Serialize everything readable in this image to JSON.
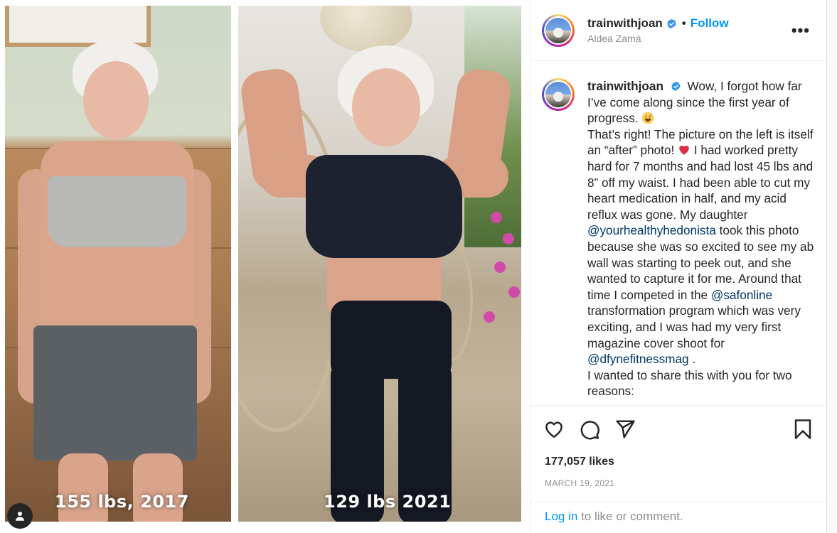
{
  "media": {
    "left_caption": "155 lbs, 2017",
    "right_caption": "129 lbs 2021"
  },
  "header": {
    "username": "trainwithjoan",
    "separator": "•",
    "follow_label": "Follow",
    "location": "Aldea Zamá",
    "more_label": "•••"
  },
  "caption": {
    "username": "trainwithjoan",
    "segments": {
      "s1": "Wow, I forgot how far I’ve come along since the first year of progress.",
      "s2": "That’s right! The picture on the left is itself an “after” photo!",
      "s3": "I had worked pretty hard for 7 months and had lost 45 lbs and 8” off my waist. I had been able to cut my heart medication in half, and my acid reflux was gone. My daughter",
      "m1": "@yourhealthyhedonista",
      "s4": "took this photo because she was so excited to see my ab wall was starting to peek out, and she wanted to capture it for me. Around that time I competed in the",
      "m2": "@safonline",
      "s5": "transformation program which was very exciting, and I was had my very first magazine cover shoot for",
      "m3": "@dfynefitnessmag",
      "s6": ".",
      "s7": "I wanted to share this with you for two reasons:"
    }
  },
  "stats": {
    "likes": "177,057 likes",
    "date": "MARCH 19, 2021"
  },
  "footer": {
    "login_label": "Log in",
    "rest": "to like or comment."
  },
  "colors": {
    "accent": "#0095f6",
    "mention": "#00376b",
    "muted": "#8e8e8e"
  },
  "icons": [
    "user-tag-icon",
    "verified-badge-icon",
    "heart-icon",
    "comment-icon",
    "share-icon",
    "bookmark-icon",
    "more-options-icon",
    "grinning-sweat-emoji",
    "red-heart-emoji"
  ]
}
